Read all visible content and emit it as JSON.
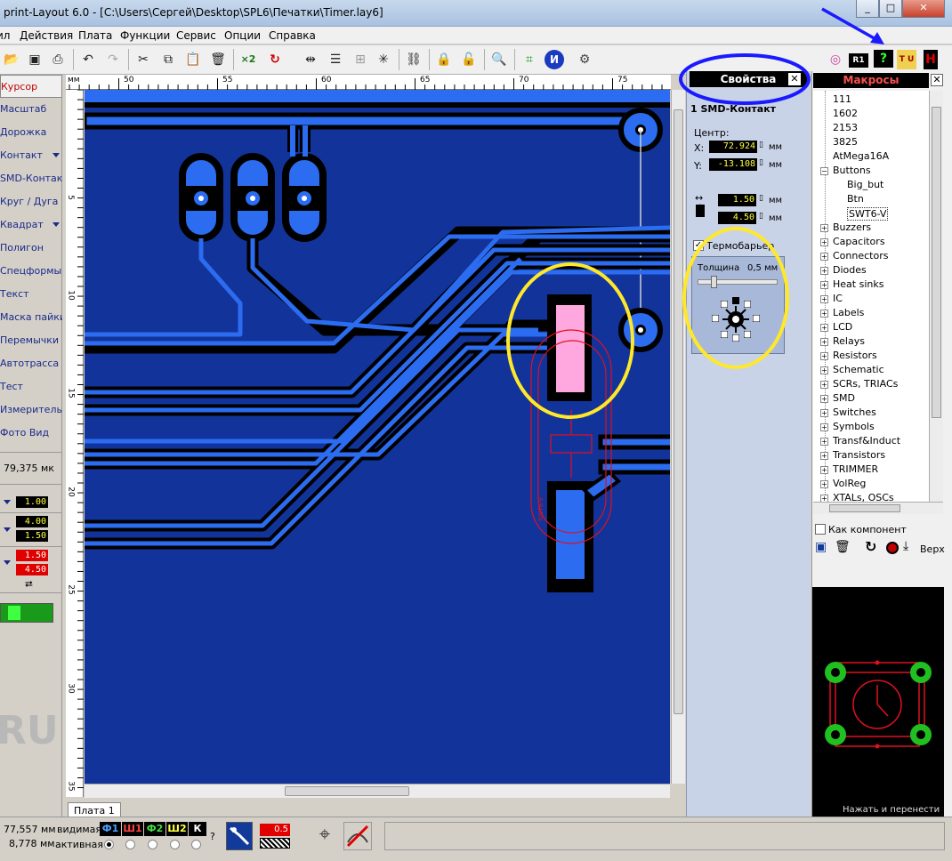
{
  "window": {
    "title": "print-Layout 6.0 - [C:\\Users\\Сергей\\Desktop\\SPL6\\Печатки\\Timer.lay6]",
    "controls": [
      "_",
      "□",
      "✕"
    ]
  },
  "menu": [
    "ил",
    "Действия",
    "Плата",
    "Функции",
    "Сервис",
    "Опции",
    "Справка"
  ],
  "toolbar": {
    "icons": [
      "open-icon",
      "save-icon",
      "print-icon",
      "undo-icon",
      "redo-icon",
      "cut-icon",
      "copy-icon",
      "paste-icon",
      "delete-icon",
      "multiply-icon",
      "rotate-icon",
      "mirror-icon",
      "align-icon",
      "group-icon",
      "snap-icon",
      "link-icon",
      "lock-icon",
      "unlock-icon",
      "zoom-icon",
      "crop-icon",
      "info-icon",
      "gear-icon"
    ],
    "multiply_label": "×2",
    "right_icons": [
      "circle-icon",
      "r1-icon",
      "help-icon",
      "tu-icon",
      "h-icon"
    ],
    "r1_label": "R1",
    "tu_label": "T U",
    "h_label": "H"
  },
  "tools": [
    {
      "label": "Курсор",
      "active": true
    },
    {
      "label": "Масштаб"
    },
    {
      "label": "Дорожка"
    },
    {
      "label": "Контакт",
      "dropdown": true
    },
    {
      "label": "SMD-Контакт"
    },
    {
      "label": "Круг / Дуга"
    },
    {
      "label": "Квадрат",
      "dropdown": true
    },
    {
      "label": "Полигон"
    },
    {
      "label": "Спецформы"
    },
    {
      "label": "Текст"
    },
    {
      "label": "Маска пайки"
    },
    {
      "label": "Перемычки"
    },
    {
      "label": "Автотрасса"
    },
    {
      "label": "Тест"
    },
    {
      "label": "Измеритель"
    },
    {
      "label": "Фото Вид"
    }
  ],
  "left_info": {
    "grid": "79,375 мк",
    "track_width": "1.00",
    "pad_outer": "4.00",
    "pad_inner": "1.50",
    "smd_w": "1.50",
    "smd_h": "4.50",
    "watermark": "RU"
  },
  "ruler_top": [
    "мм",
    "50",
    "55",
    "60",
    "65",
    "70",
    "75"
  ],
  "ruler_left": [
    "5",
    "10",
    "15",
    "20",
    "25",
    "30",
    "35"
  ],
  "tab": "Плата 1",
  "properties": {
    "title": "Свойства",
    "subtitle": "1 SMD-Контакт",
    "center_label": "Центр:",
    "x_label": "X:",
    "x_value": "72.924",
    "y_label": "Y:",
    "y_value": "-13.108",
    "unit": "мм",
    "width_value": "1.50",
    "height_value": "4.50",
    "thermal_label": "Термобарьер",
    "thermal_checked": true,
    "thickness_label": "Толщина",
    "thickness_value": "0,5 мм"
  },
  "macros": {
    "title": "Макросы",
    "items": [
      {
        "label": "111",
        "level": 1
      },
      {
        "label": "1602",
        "level": 1
      },
      {
        "label": "2153",
        "level": 1
      },
      {
        "label": "3825",
        "level": 1
      },
      {
        "label": "AtMega16A",
        "level": 1
      },
      {
        "label": "Buttons",
        "level": 0,
        "expanded": true
      },
      {
        "label": "Big_but",
        "level": 2
      },
      {
        "label": "Btn",
        "level": 2
      },
      {
        "label": "SWT6-V",
        "level": 2,
        "selected": true
      },
      {
        "label": "Buzzers",
        "level": 0
      },
      {
        "label": "Capacitors",
        "level": 0
      },
      {
        "label": "Connectors",
        "level": 0
      },
      {
        "label": "Diodes",
        "level": 0
      },
      {
        "label": "Heat sinks",
        "level": 0
      },
      {
        "label": "IC",
        "level": 0
      },
      {
        "label": "Labels",
        "level": 0
      },
      {
        "label": "LCD",
        "level": 0
      },
      {
        "label": "Relays",
        "level": 0
      },
      {
        "label": "Resistors",
        "level": 0
      },
      {
        "label": "Schematic",
        "level": 0
      },
      {
        "label": "SCRs, TRIACs",
        "level": 0
      },
      {
        "label": "SMD",
        "level": 0
      },
      {
        "label": "Switches",
        "level": 0
      },
      {
        "label": "Symbols",
        "level": 0
      },
      {
        "label": "Transf&Induct",
        "level": 0
      },
      {
        "label": "Transistors",
        "level": 0
      },
      {
        "label": "TRIMMER",
        "level": 0
      },
      {
        "label": "VolReg",
        "level": 0
      },
      {
        "label": "XTALs, OSCs",
        "level": 0
      }
    ],
    "as_component": "Как компонент",
    "top_label": "Верх",
    "drag_hint": "Нажать и перенести"
  },
  "status": {
    "x": "77,557 мм",
    "y": "8,778 мм",
    "visible_label": "видимая",
    "active_label": "активная",
    "layers": [
      {
        "label": "Ф1",
        "color": "#4aa0ff"
      },
      {
        "label": "Ш1",
        "color": "#ff4040"
      },
      {
        "label": "Ф2",
        "color": "#40e040"
      },
      {
        "label": "Ш2",
        "color": "#ffff40"
      },
      {
        "label": "К",
        "color": "#ffffff"
      }
    ],
    "help": "?",
    "zoom_value": "0.5"
  },
  "colors": {
    "board": "#12349a",
    "copper": "#2b6cf0",
    "annotation_blue": "#1a1aff",
    "annotation_yellow": "#ffe82a"
  }
}
